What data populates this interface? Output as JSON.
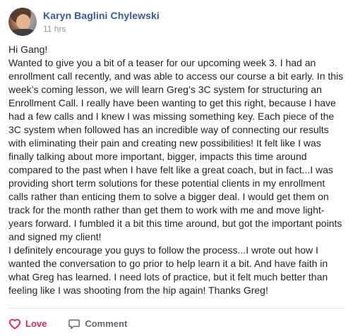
{
  "post": {
    "author": "Karyn Baglini Chylewski",
    "timestamp": "11 hrs",
    "body": "Hi Gang!\nWanted to give you a bit of a teaser for our upcoming week 3. I had an enrollment call recently, and was able to access our course a bit early. In this week’s coming lesson, we will learn Greg’s 3C system for structuring an Enrollment Call. I really have been wanting to get this right, because I have had a few calls and I knew I was missing something key. Each piece of the 3C system when followed has an incredible way of connecting our results with eliminating their pain and creating new possibilities! It felt like I was finally talking about more important, bigger, impacts this time around compared to the past when I have felt like a great coach, but in fact...I was providing short term solutions for these potential clients in my enrollment calls rather than enticing them to solve a bigger deal. I would get them on track for the month rather than get them to work with me and move light-years forward. I fumbled it a bit this time around, but got the important points and signed my client!\nI definitely encourage you guys to follow the process...I wrote out how I wanted the conversation to go prior to help learn it a bit. And have faith in what Greg has learned. I need lots of practice, but it felt much better than feeling like I was shooting from the hip again! Thanks Greg!"
  },
  "actions": {
    "love_label": "Love",
    "comment_label": "Comment"
  },
  "colors": {
    "author_link": "#385898",
    "love_accent": "#e0245e",
    "muted": "#606770"
  },
  "icons": {
    "avatar": "avatar-photo",
    "love": "heart-outline-icon",
    "comment": "speech-bubble-icon"
  }
}
